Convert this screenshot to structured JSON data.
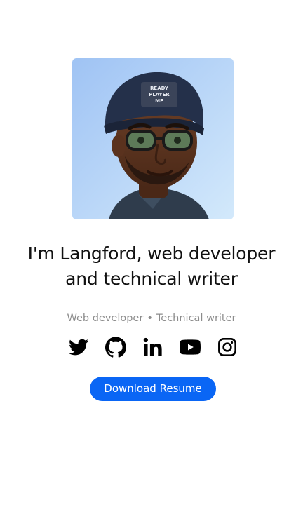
{
  "profile": {
    "avatar_alt": "Avatar",
    "beanie_text_line1": "READY",
    "beanie_text_line2": "PLAYER",
    "beanie_text_line3": "ME",
    "headline_line1": "I'm Langford, web developer",
    "headline_line2": "and technical writer",
    "tag_1": "Web developer",
    "tag_separator": "•",
    "tag_2": "Technical writer"
  },
  "socials": [
    {
      "name": "twitter-icon"
    },
    {
      "name": "github-icon"
    },
    {
      "name": "linkedin-icon"
    },
    {
      "name": "youtube-icon"
    },
    {
      "name": "instagram-icon"
    }
  ],
  "cta": {
    "label": "Download Resume"
  },
  "colors": {
    "accent": "#0a66f5",
    "text": "#111111",
    "muted": "#8c8c8c",
    "avatar_bg_start": "#a9ccf5",
    "avatar_bg_end": "#cfe6fb"
  }
}
